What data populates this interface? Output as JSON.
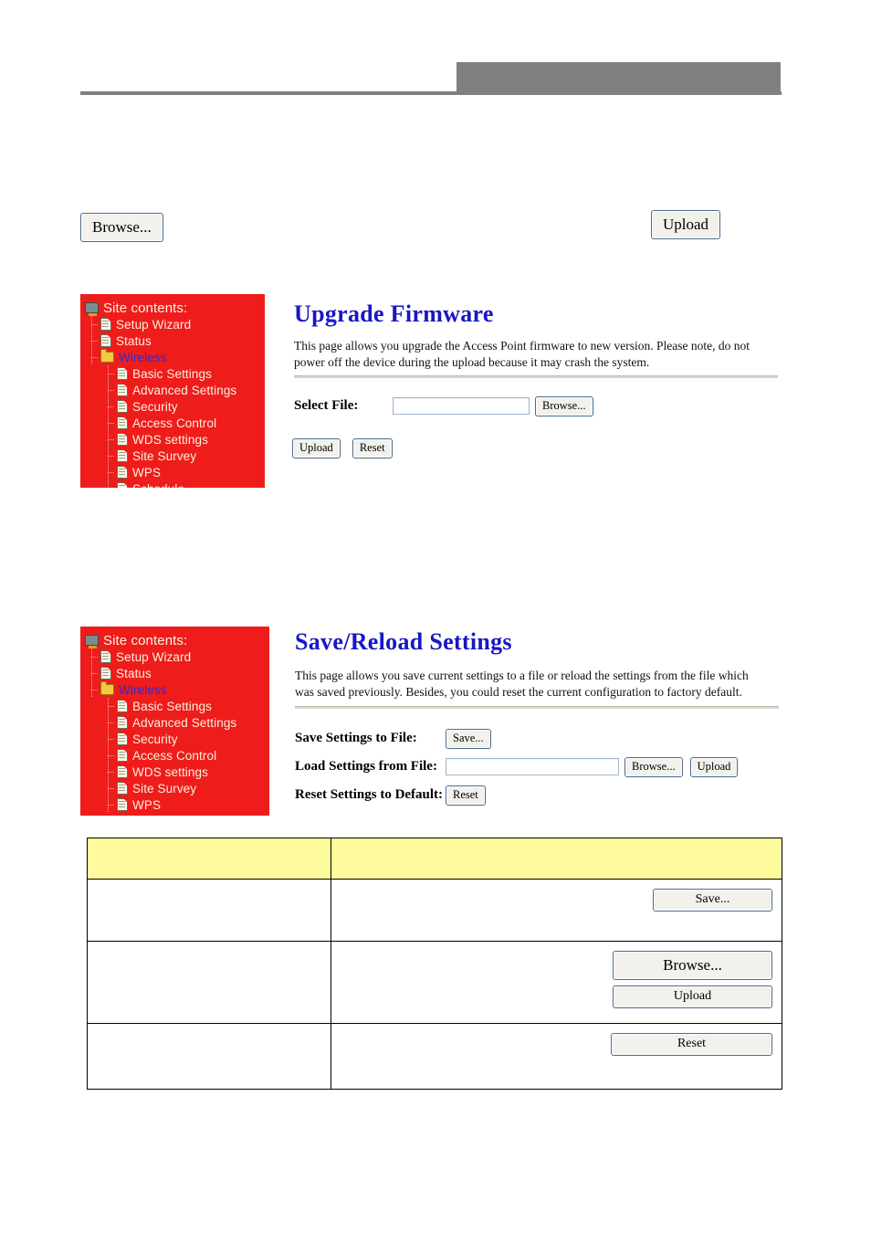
{
  "header": {
    "gray_block": "",
    "rule": ""
  },
  "top_buttons": {
    "browse_label": "Browse...",
    "upload_label": "Upload"
  },
  "colors": {
    "sidebar_red": "#EF1C1C",
    "title_blue": "#1717C4",
    "link_blue": "#2B2BD6",
    "table_header_yellow": "#FDFB9C",
    "header_gray": "#808080"
  },
  "sidebar": {
    "root_label": "Site contents:",
    "items": [
      {
        "label": "Setup Wizard",
        "icon": "page-icon",
        "level": 1,
        "link": false
      },
      {
        "label": "Status",
        "icon": "page-icon",
        "level": 1,
        "link": false
      },
      {
        "label": "Wireless",
        "icon": "folder-icon",
        "level": 1,
        "link": true
      },
      {
        "label": "Basic Settings",
        "icon": "page-icon",
        "level": 2,
        "link": false
      },
      {
        "label": "Advanced Settings",
        "icon": "page-icon",
        "level": 2,
        "link": false
      },
      {
        "label": "Security",
        "icon": "page-icon",
        "level": 2,
        "link": false
      },
      {
        "label": "Access Control",
        "icon": "page-icon",
        "level": 2,
        "link": false
      },
      {
        "label": "WDS settings",
        "icon": "page-icon",
        "level": 2,
        "link": false
      },
      {
        "label": "Site Survey",
        "icon": "page-icon",
        "level": 2,
        "link": false
      },
      {
        "label": "WPS",
        "icon": "page-icon",
        "level": 2,
        "link": false
      },
      {
        "label": "Schedule",
        "icon": "page-icon",
        "level": 2,
        "link": false
      }
    ]
  },
  "firmware_panel": {
    "title": "Upgrade Firmware",
    "description": "This page allows you upgrade the Access Point firmware to new version. Please note, do not power off the device during the upload because it may crash the system.",
    "select_file_label": "Select File:",
    "select_file_value": "",
    "select_file_placeholder": "",
    "browse_label": "Browse...",
    "upload_label": "Upload",
    "reset_label": "Reset"
  },
  "savereload_panel": {
    "title": "Save/Reload Settings",
    "description": "This page allows you save current settings to a file or reload the settings from the file which was saved previously. Besides, you could reset the current configuration to factory default.",
    "rows": [
      {
        "label": "Save Settings to File:",
        "save_label": "Save..."
      },
      {
        "label": "Load Settings from File:",
        "value": "",
        "browse_label": "Browse...",
        "upload_label": "Upload"
      },
      {
        "label": "Reset Settings to Default:",
        "reset_label": "Reset"
      }
    ]
  },
  "desc_table": {
    "headers": [
      "",
      ""
    ],
    "rows": [
      {
        "term": "",
        "desc": "",
        "buttons": [
          "Save..."
        ]
      },
      {
        "term": "",
        "desc": "",
        "buttons": [
          "Browse...",
          "Upload"
        ]
      },
      {
        "term": "",
        "desc": "",
        "buttons": [
          "Reset"
        ]
      }
    ]
  }
}
